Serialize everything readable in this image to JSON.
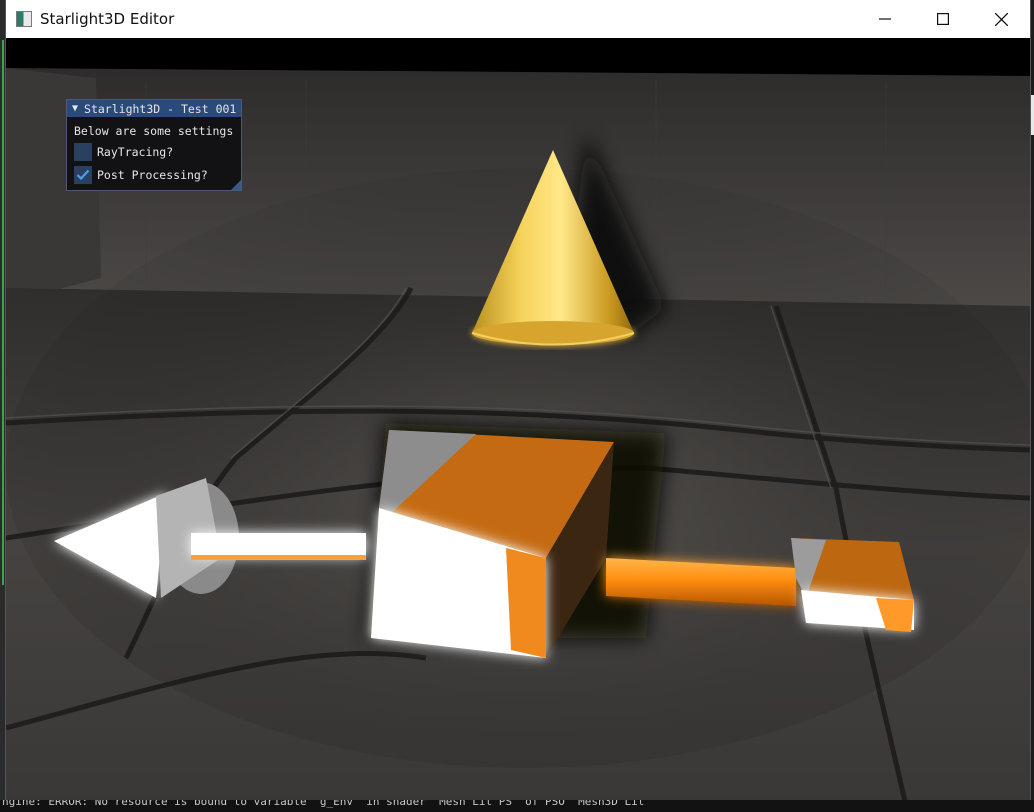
{
  "window": {
    "title": "Starlight3D Editor",
    "icons": {
      "app": "app-icon",
      "minimize": "minimize-icon",
      "maximize": "maximize-icon",
      "close": "close-icon"
    }
  },
  "imgui_panel": {
    "title": "Starlight3D - Test 001",
    "collapse_icon": "collapse-arrow-icon",
    "description": "Below are some settings",
    "options": [
      {
        "label": "RayTracing?",
        "checked": false
      },
      {
        "label": "Post Processing?",
        "checked": true
      }
    ],
    "colors": {
      "title_bg": "#294a7a",
      "checkbox_bg": "#29405e",
      "check_mark": "#4f9cf0"
    }
  },
  "console": {
    "text": "ngine: ERROR: No resource is bound to variable 'g_Env' in shader 'Mesh Lit   PS' of PSO 'Mesh3D   Lit"
  }
}
